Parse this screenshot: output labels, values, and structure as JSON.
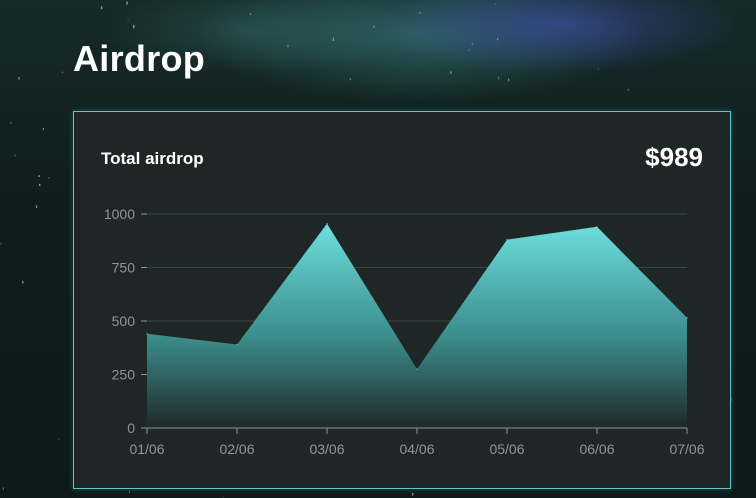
{
  "page": {
    "title": "Airdrop"
  },
  "card": {
    "label": "Total airdrop",
    "total": "$989"
  },
  "colors": {
    "accent": "#57c9c9",
    "fill_top": "#6ee0e0",
    "fill_bottom": "#1f2726",
    "background": "#0f1d1c"
  },
  "chart_data": {
    "type": "area",
    "title": "Total airdrop",
    "xlabel": "",
    "ylabel": "",
    "x": [
      "01/06",
      "02/06",
      "03/06",
      "04/06",
      "05/06",
      "06/06",
      "07/06"
    ],
    "series": [
      {
        "values": [
          440,
          390,
          955,
          275,
          880,
          940,
          515
        ]
      }
    ],
    "yticks": [
      0,
      250,
      500,
      750,
      1000
    ],
    "ylim": [
      0,
      1000
    ],
    "grid": true
  }
}
